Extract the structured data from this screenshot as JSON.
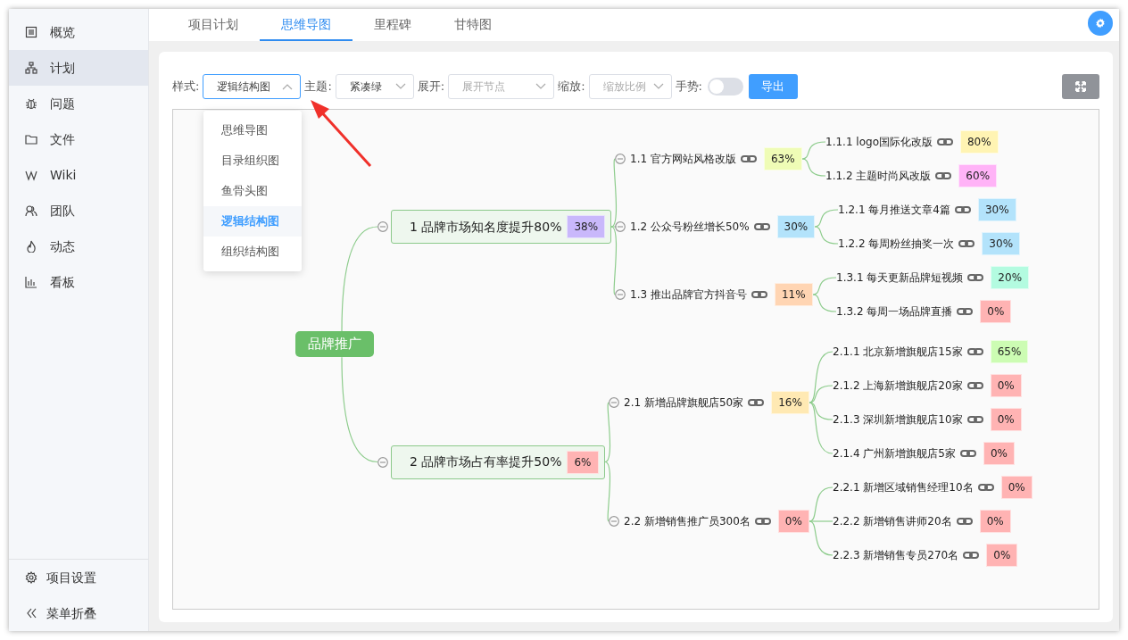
{
  "sidebar": {
    "items": [
      {
        "label": "概览",
        "selected": false
      },
      {
        "label": "计划",
        "selected": true
      },
      {
        "label": "问题",
        "selected": false
      },
      {
        "label": "文件",
        "selected": false
      },
      {
        "label": "Wiki",
        "selected": false
      },
      {
        "label": "团队",
        "selected": false
      },
      {
        "label": "动态",
        "selected": false
      },
      {
        "label": "看板",
        "selected": false
      }
    ],
    "footer": [
      {
        "label": "项目设置"
      },
      {
        "label": "菜单折叠"
      }
    ]
  },
  "tabs": [
    {
      "label": "项目计划",
      "selected": false
    },
    {
      "label": "思维导图",
      "selected": true
    },
    {
      "label": "里程碑",
      "selected": false
    },
    {
      "label": "甘特图",
      "selected": false
    }
  ],
  "toolbar": {
    "style": {
      "label": "样式:",
      "value": "逻辑结构图",
      "open": true,
      "options": [
        {
          "label": "思维导图",
          "selected": false
        },
        {
          "label": "目录组织图",
          "selected": false
        },
        {
          "label": "鱼骨头图",
          "selected": false
        },
        {
          "label": "逻辑结构图",
          "selected": true
        },
        {
          "label": "组织结构图",
          "selected": false
        }
      ]
    },
    "theme": {
      "label": "主题:",
      "value": "紧凑绿"
    },
    "expand": {
      "label": "展开:",
      "placeholder": "展开节点"
    },
    "zoom": {
      "label": "缩放:",
      "placeholder": "缩放比例"
    },
    "gesture": {
      "label": "手势:",
      "on": false
    },
    "export_button": "导出"
  },
  "mindmap": {
    "root": {
      "label": "品牌推广",
      "children": [
        {
          "label": "1 品牌市场知名度提升80%",
          "progress": "38%",
          "color": "#c9b8fb",
          "expanded": true,
          "children": [
            {
              "label": "1.1 官方网站风格改版",
              "progress": "63%",
              "color": "#effcb6",
              "expanded": true,
              "children": [
                {
                  "label": "1.1.1 logo国际化改版",
                  "progress": "80%",
                  "color": "#fff4b3"
                },
                {
                  "label": "1.1.2 主题时尚风改版",
                  "progress": "60%",
                  "color": "#ffb3f7"
                }
              ]
            },
            {
              "label": "1.2 公众号粉丝增长50%",
              "progress": "30%",
              "color": "#b3e3fb",
              "expanded": true,
              "children": [
                {
                  "label": "1.2.1 每月推送文章4篇",
                  "progress": "30%",
                  "color": "#b3e3fb"
                },
                {
                  "label": "1.2.2 每周粉丝抽奖一次",
                  "progress": "30%",
                  "color": "#b3e3fb"
                }
              ]
            },
            {
              "label": "1.3 推出品牌官方抖音号",
              "progress": "11%",
              "color": "#ffd5b3",
              "expanded": true,
              "children": [
                {
                  "label": "1.3.1 每天更新品牌短视频",
                  "progress": "20%",
                  "color": "#b3fbe0"
                },
                {
                  "label": "1.3.2 每周一场品牌直播",
                  "progress": "0%",
                  "color": "#ffb3b3"
                }
              ]
            }
          ]
        },
        {
          "label": "2 品牌市场占有率提升50%",
          "progress": "6%",
          "color": "#ffb3b3",
          "expanded": true,
          "children": [
            {
              "label": "2.1 新增品牌旗舰店50家",
              "progress": "16%",
              "color": "#ffe9b3",
              "expanded": true,
              "children": [
                {
                  "label": "2.1.1 北京新增旗舰店15家",
                  "progress": "65%",
                  "color": "#ccfcb3"
                },
                {
                  "label": "2.1.2 上海新增旗舰店20家",
                  "progress": "0%",
                  "color": "#ffb3b3"
                },
                {
                  "label": "2.1.3 深圳新增旗舰店10家",
                  "progress": "0%",
                  "color": "#ffb3b3"
                },
                {
                  "label": "2.1.4 广州新增旗舰店5家",
                  "progress": "0%",
                  "color": "#ffb3b3"
                }
              ]
            },
            {
              "label": "2.2 新增销售推广员300名",
              "progress": "0%",
              "color": "#ffb3b3",
              "expanded": true,
              "children": [
                {
                  "label": "2.2.1 新增区域销售经理10名",
                  "progress": "0%",
                  "color": "#ffb3b3"
                },
                {
                  "label": "2.2.2 新增销售讲师20名",
                  "progress": "0%",
                  "color": "#ffb3b3"
                },
                {
                  "label": "2.2.3 新增销售专员270名",
                  "progress": "0%",
                  "color": "#ffb3b3"
                }
              ]
            }
          ]
        }
      ]
    }
  }
}
